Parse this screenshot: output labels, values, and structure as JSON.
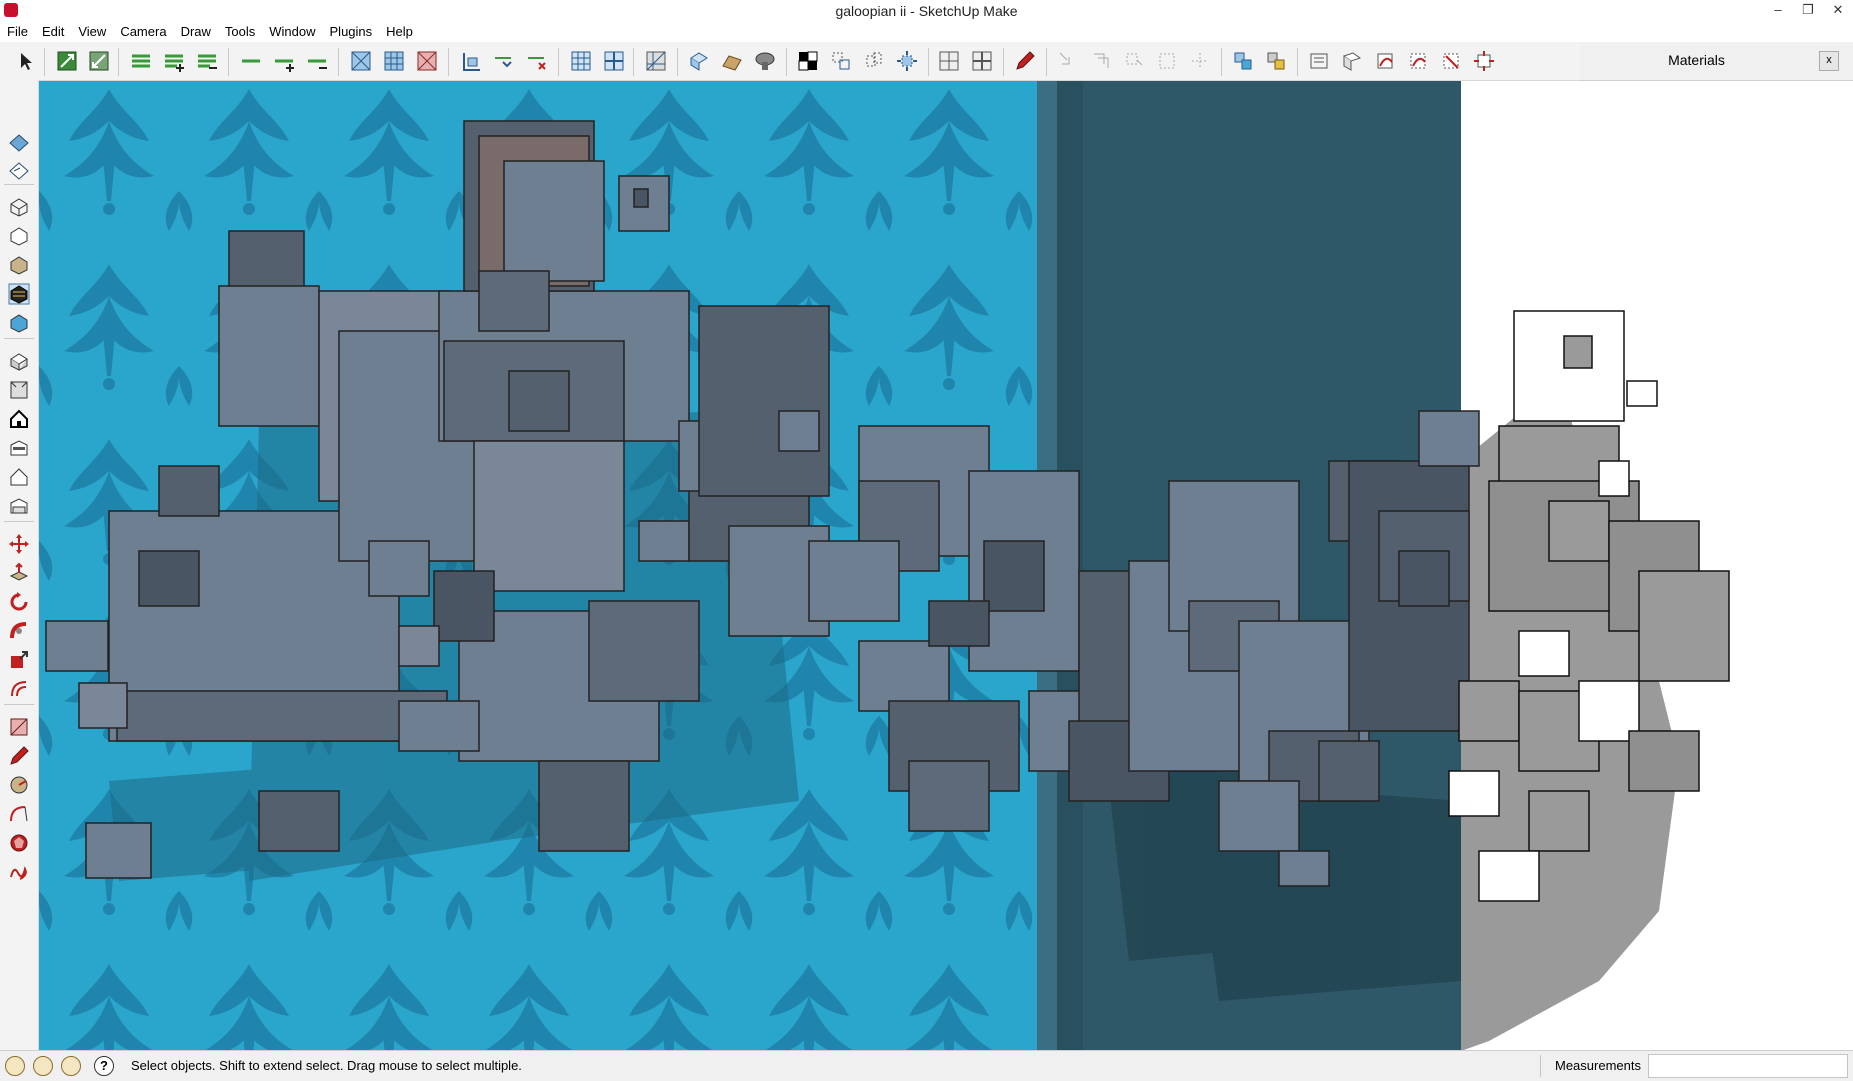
{
  "window": {
    "title": "galoopian ii - SketchUp Make",
    "buttons": [
      "–",
      "❐",
      "✕"
    ]
  },
  "menu": [
    "File",
    "Edit",
    "View",
    "Camera",
    "Draw",
    "Tools",
    "Window",
    "Plugins",
    "Help"
  ],
  "materials_panel": {
    "title": "Materials",
    "close": "x"
  },
  "status": {
    "hint": "Select objects. Shift to extend select. Drag mouse to select multiple.",
    "measurements_label": "Measurements",
    "help_icon": "?"
  },
  "colors": {
    "wall_blue": "#2aa6cd",
    "dark_teal": "#2e5868",
    "block_face": "#6f7f92",
    "block_dark": "#4a5563",
    "shadow_grey": "#9a9a9a"
  }
}
